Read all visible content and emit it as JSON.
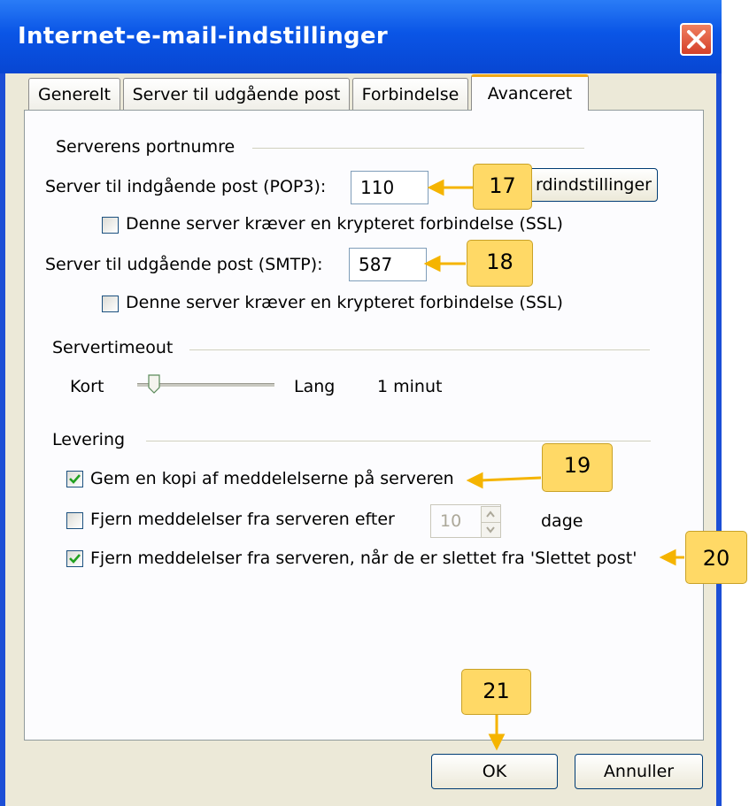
{
  "window": {
    "title": "Internet-e-mail-indstillinger"
  },
  "tabs": [
    "Generelt",
    "Server til udgående post",
    "Forbindelse",
    "Avanceret"
  ],
  "ports": {
    "section_label": "Serverens portnumre",
    "incoming_label": "Server til indgående post (POP3):",
    "incoming_value": "110",
    "incoming_ssl_label": "Denne server kræver en krypteret forbindelse (SSL)",
    "outgoing_label": "Server til udgående post (SMTP):",
    "outgoing_value": "587",
    "outgoing_ssl_label": "Denne server kræver en krypteret forbindelse (SSL)",
    "defaults_button": "rdindstillinger"
  },
  "timeout": {
    "section_label": "Servertimeout",
    "short_label": "Kort",
    "long_label": "Lang",
    "value": "1 minut"
  },
  "delivery": {
    "section_label": "Levering",
    "keep_copy_label": "Gem en kopi af meddelelserne på serveren",
    "keep_copy_checked": true,
    "remove_after_label": "Fjern meddelelser fra serveren efter",
    "remove_after_checked": false,
    "days_value": "10",
    "days_unit": "dage",
    "remove_deleted_label": "Fjern meddelelser fra serveren, når de er slettet fra 'Slettet post'",
    "remove_deleted_checked": true
  },
  "buttons": {
    "ok": "OK",
    "cancel": "Annuller"
  },
  "callouts": [
    "17",
    "18",
    "19",
    "20",
    "21"
  ],
  "colors": {
    "titlebar": "#0a55e6",
    "tab_highlight": "#f0a818",
    "callout_fill": "#ffd966",
    "arrow": "#f5b400"
  }
}
